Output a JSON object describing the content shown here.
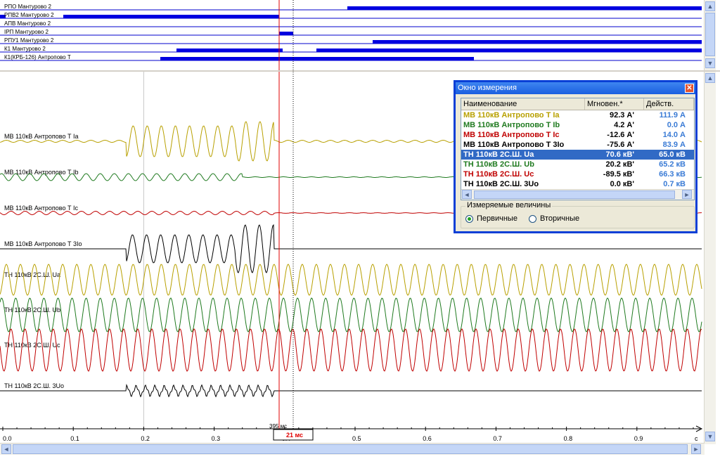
{
  "top_signals": [
    {
      "label": "РПО  Мантурово 2"
    },
    {
      "label": "РПВ2 Мантурово 2"
    },
    {
      "label": "АПВ  Мантурово 2"
    },
    {
      "label": "ІРП Мантурово 2"
    },
    {
      "label": "РПУ1 Мантурово 2"
    },
    {
      "label": "К1 Мантурово 2"
    },
    {
      "label": "К1(КРБ-126) Антропово Т"
    }
  ],
  "channels": [
    {
      "label": "МВ 110кВ Антропово Т Ia",
      "color": "#b8a000"
    },
    {
      "label": "МВ 110кВ Антропово Т Ib",
      "color": "#1f7a1f"
    },
    {
      "label": "МВ 110кВ Антропово Т Ic",
      "color": "#c00000"
    },
    {
      "label": "МВ 110кВ Антропово Т 3Io",
      "color": "#000000"
    },
    {
      "label": "ТН 110кВ 2С.Ш. Ua",
      "color": "#b8a000"
    },
    {
      "label": "ТН 110кВ 2С.Ш. Ub",
      "color": "#1f7a1f"
    },
    {
      "label": "ТН 110кВ 2С.Ш. Uc",
      "color": "#c00000"
    },
    {
      "label": "ТН 110кВ 2С.Ш. 3Uo",
      "color": "#000000"
    }
  ],
  "cursor": {
    "time_label": "395 мс",
    "delta_label": "21 мс"
  },
  "time_axis": {
    "ticks": [
      "0.0",
      "0.1",
      "0.2",
      "0.3",
      "0.4",
      "0.5",
      "0.6",
      "0.7",
      "0.8",
      "0.9"
    ],
    "unit": "с"
  },
  "measure_window": {
    "title": "Окно измерения",
    "columns": [
      "Наименование",
      "Мгновен.*",
      "Действ."
    ],
    "rows": [
      {
        "name": "МВ 110кВ Антропово Т Ia",
        "inst": "92.3  А'",
        "rms": "111.9  А",
        "color": "#b8a000"
      },
      {
        "name": "МВ 110кВ Антропово Т Ib",
        "inst": "4.2  А'",
        "rms": "0.0  А",
        "color": "#1f7a1f"
      },
      {
        "name": "МВ 110кВ Антропово Т Ic",
        "inst": "-12.6  А'",
        "rms": "14.0  А",
        "color": "#c00000"
      },
      {
        "name": "МВ 110кВ Антропово Т 3Io",
        "inst": "-75.6  А'",
        "rms": "83.9  А",
        "color": "#000000"
      },
      {
        "name": "ТН 110кВ 2С.Ш. Ua",
        "inst": "70.6  кВ'",
        "rms": "65.0  кВ",
        "color": "#b8a000",
        "selected": true
      },
      {
        "name": "ТН 110кВ 2С.Ш. Ub",
        "inst": "20.2  кВ'",
        "rms": "65.2  кВ",
        "color": "#1f7a1f"
      },
      {
        "name": "ТН 110кВ 2С.Ш. Uc",
        "inst": "-89.5  кВ'",
        "rms": "66.3  кВ",
        "color": "#c00000"
      },
      {
        "name": "ТН 110кВ 2С.Ш. 3Uo",
        "inst": "0.0  кВ'",
        "rms": "0.7  кВ",
        "color": "#000000"
      }
    ],
    "group_label": "Измеряемые величины",
    "options": [
      {
        "label": "Первичные",
        "checked": true
      },
      {
        "label": "Вторичные",
        "checked": false
      }
    ]
  }
}
